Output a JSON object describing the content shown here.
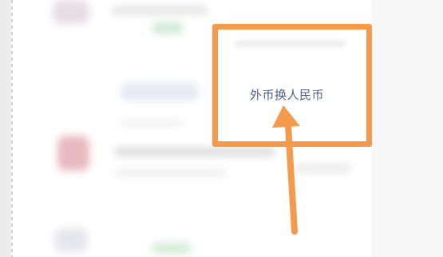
{
  "card": {
    "label": "外币换人民币"
  },
  "colors": {
    "highlight": "#f39a4c",
    "label_text": "#4f5f87"
  },
  "icons": [
    "up-arrow-icon"
  ]
}
